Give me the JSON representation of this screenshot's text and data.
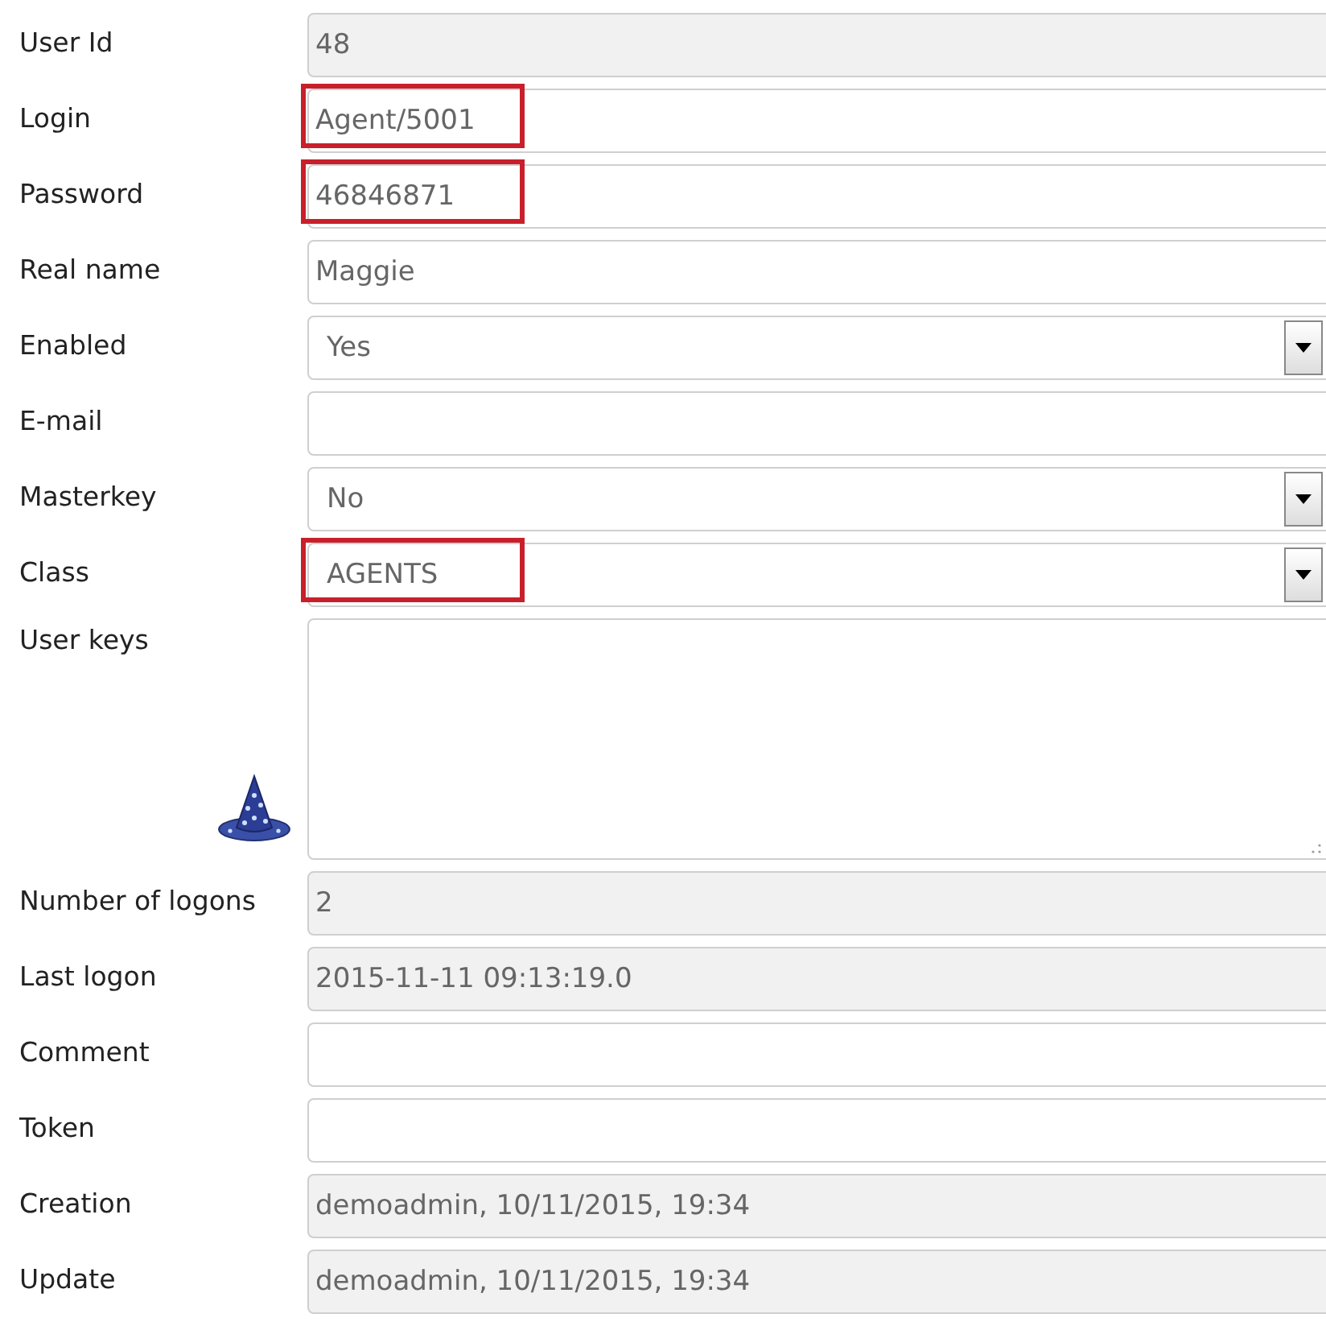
{
  "fields": [
    {
      "label": "User Id",
      "kind": "readonly",
      "value": "48",
      "highlighted": false
    },
    {
      "label": "Login",
      "kind": "text",
      "value": "Agent/5001",
      "highlighted": true
    },
    {
      "label": "Password",
      "kind": "text",
      "value": "46846871",
      "highlighted": true
    },
    {
      "label": "Real name",
      "kind": "text",
      "value": "Maggie",
      "highlighted": false
    },
    {
      "label": "Enabled",
      "kind": "select",
      "value": "Yes",
      "highlighted": false
    },
    {
      "label": "E-mail",
      "kind": "text",
      "highlighted": false
    },
    {
      "label": "Masterkey",
      "kind": "select",
      "value": "No",
      "highlighted": false
    },
    {
      "label": "Class",
      "kind": "select",
      "value": "AGENTS",
      "highlighted": true
    },
    {
      "label": "User keys",
      "kind": "textarea",
      "highlighted": false
    },
    {
      "label": "Number of logons",
      "kind": "readonly",
      "value": "2",
      "highlighted": false
    },
    {
      "label": "Last logon",
      "kind": "readonly",
      "value": "2015-11-11 09:13:19.0",
      "highlighted": false
    },
    {
      "label": "Comment",
      "kind": "text",
      "highlighted": false
    },
    {
      "label": "Token",
      "kind": "text",
      "highlighted": false
    },
    {
      "label": "Creation",
      "kind": "readonly",
      "value": "demoadmin, 10/11/2015, 19:34",
      "highlighted": false
    },
    {
      "label": "Update",
      "kind": "readonly",
      "value": "demoadmin, 10/11/2015, 19:34",
      "highlighted": false
    }
  ]
}
